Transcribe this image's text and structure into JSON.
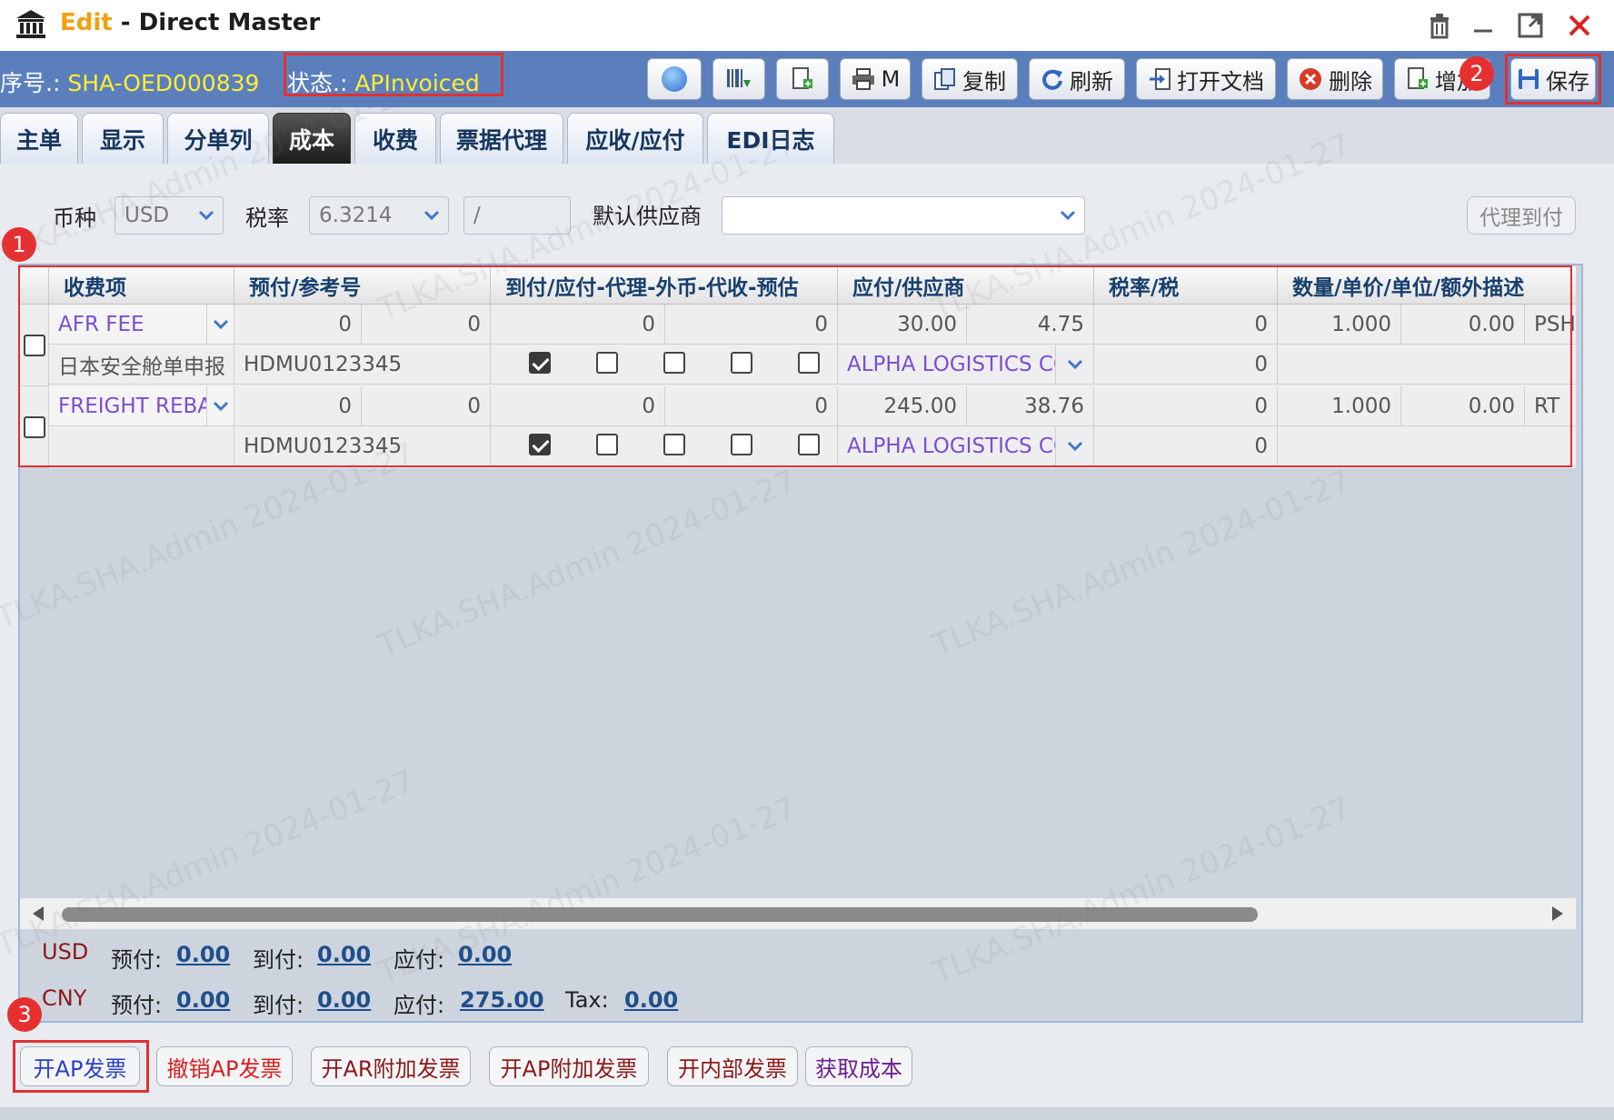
{
  "window": {
    "edit_word": "Edit",
    "title": "Direct Master"
  },
  "header": {
    "serial_label": "序号.:",
    "serial_value": "SHA-OED000839",
    "status_label": "状态.:",
    "status_value": "APInvoiced",
    "toolbar": {
      "m_label": "M",
      "copy_label": "复制",
      "refresh_label": "刷新",
      "open_doc_label": "打开文档",
      "delete_label": "删除",
      "add_label": "增加",
      "save_label": "保存"
    }
  },
  "tabs": [
    "主单",
    "显示",
    "分单列",
    "成本",
    "收费",
    "票据代理",
    "应收/应付",
    "EDI日志"
  ],
  "active_tab": "成本",
  "filters": {
    "currency_label": "币种",
    "currency_value": "USD",
    "tax_rate_label": "税率",
    "tax_rate_value": "6.3214",
    "tax_extra_value": "/",
    "vendor_label": "默认供应商",
    "vendor_value": "",
    "agent_collect_label": "代理到付"
  },
  "grid": {
    "headers": [
      "收费项",
      "预付/参考号",
      "到付/应付-代理-外币-代收-预估",
      "应付/供应商",
      "税率/税",
      "数量/单价/单位/额外描述"
    ],
    "rows": [
      {
        "charge": "AFR FEE",
        "remark": "日本安全舱单申报",
        "prepaid_a": "0",
        "prepaid_b": "0",
        "ref_no": "HDMU0123345",
        "collect_a": "0",
        "collect_b": "0",
        "payable": "30.00",
        "payable_b": "4.75",
        "vendor": "ALPHA LOGISTICS CO",
        "tax": "0",
        "tax_b": "0",
        "qty": "1.000",
        "unit_price": "0.00",
        "unit": "PSH",
        "flags": [
          true,
          false,
          false,
          false,
          false
        ]
      },
      {
        "charge": "FREIGHT REBATE",
        "remark": "",
        "prepaid_a": "0",
        "prepaid_b": "0",
        "ref_no": "HDMU0123345",
        "collect_a": "0",
        "collect_b": "0",
        "payable": "245.00",
        "payable_b": "38.76",
        "vendor": "ALPHA LOGISTICS CO",
        "tax": "0",
        "tax_b": "0",
        "qty": "1.000",
        "unit_price": "0.00",
        "unit": "RT",
        "flags": [
          true,
          false,
          false,
          false,
          false
        ]
      }
    ]
  },
  "summary": {
    "usd": {
      "currency": "USD",
      "prepaid_label": "预付:",
      "prepaid": "0.00",
      "collect_label": "到付:",
      "collect": "0.00",
      "payable_label": "应付:",
      "payable": "0.00"
    },
    "cny": {
      "currency": "CNY",
      "prepaid_label": "预付:",
      "prepaid": "0.00",
      "collect_label": "到付:",
      "collect": "0.00",
      "payable_label": "应付:",
      "payable": "275.00",
      "tax_label": "Tax:",
      "tax": "0.00"
    }
  },
  "actions": {
    "open_ap_invoice": "开AP发票",
    "cancel_ap_invoice": "撤销AP发票",
    "open_ar_extra_invoice": "开AR附加发票",
    "open_ap_extra_invoice": "开AP附加发票",
    "open_internal_invoice": "开内部发票",
    "get_cost": "获取成本"
  },
  "annotations": {
    "badge_1": "1",
    "badge_2": "2",
    "badge_3": "3"
  },
  "watermark": "TLKA.SHA.Admin 2024-01-27",
  "colors": {
    "header_bg": "#5b7fbd",
    "highlight_yellow": "#ffee33",
    "annotation_red": "#e23030",
    "link_blue": "#1f4f8a",
    "vendor_purple": "#7b4fd0"
  }
}
